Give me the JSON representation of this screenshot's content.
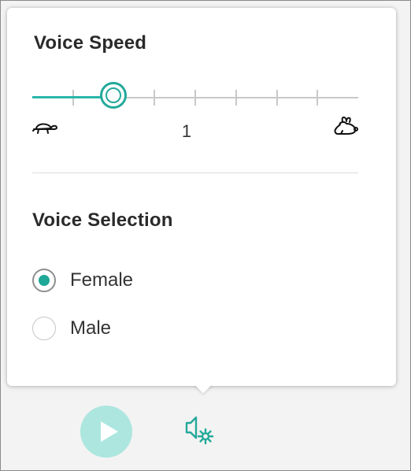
{
  "voice_speed": {
    "title": "Voice Speed",
    "value_label": "1",
    "slider": {
      "value_fraction": 0.25,
      "tick_count": 9,
      "min_icon": "turtle-icon",
      "max_icon": "rabbit-icon"
    }
  },
  "voice_selection": {
    "title": "Voice Selection",
    "options": [
      {
        "label": "Female",
        "selected": true
      },
      {
        "label": "Male",
        "selected": false
      }
    ]
  },
  "bottom_bar": {
    "play_icon": "play-icon",
    "settings_icon": "speaker-gear-icon"
  },
  "colors": {
    "accent": "#23a99a",
    "radio_fill": "#1fa797",
    "play_button_bg": "#ace6df",
    "track": "#c8c8c8"
  }
}
